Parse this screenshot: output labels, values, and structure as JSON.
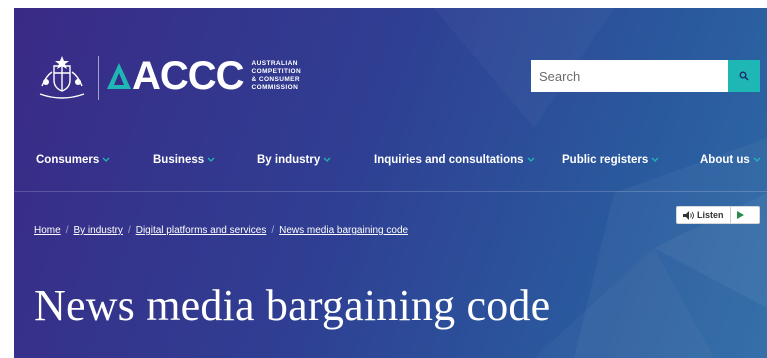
{
  "header": {
    "logo_text": "ACCC",
    "logo_subtitle": [
      "AUSTRALIAN",
      "COMPETITION",
      "& CONSUMER",
      "COMMISSION"
    ],
    "search_placeholder": "Search"
  },
  "nav": {
    "items": [
      {
        "label": "Consumers"
      },
      {
        "label": "Business"
      },
      {
        "label": "By industry"
      },
      {
        "label": "Inquiries and consultations"
      },
      {
        "label": "Public registers"
      },
      {
        "label": "About us"
      }
    ]
  },
  "breadcrumb": [
    "Home",
    "By industry",
    "Digital platforms and services",
    "News media bargaining code"
  ],
  "listen": {
    "label": "Listen"
  },
  "page": {
    "title": "News media bargaining code"
  },
  "colors": {
    "accent": "#1fb6b6",
    "background_start": "#3a2a86",
    "background_end": "#2d6aa6"
  },
  "icons": {
    "search": "search-icon",
    "speaker": "speaker-icon",
    "play": "play-icon",
    "chevron": "chevron-down-icon",
    "crest": "coat-of-arms-icon"
  }
}
